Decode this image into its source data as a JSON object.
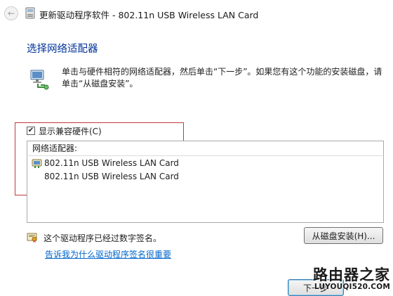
{
  "window": {
    "title": "更新驱动程序软件 - 802.11n USB Wireless LAN Card"
  },
  "main": {
    "heading": "选择网络适配器",
    "instruction": "单击与硬件相符的网络适配器，然后单击“下一步”。如果您有这个功能的安装磁盘，请单击“从磁盘安装”。",
    "show_compatible": {
      "label": "显示兼容硬件(C)",
      "checked": true
    },
    "list": {
      "header": "网络适配器:",
      "items": [
        {
          "label": "802.11n USB Wireless LAN Card",
          "icon": "network-adapter-icon"
        },
        {
          "label": "802.11n USB Wireless LAN Card"
        }
      ]
    },
    "signed_text": "这个驱动程序已经过数字签名。",
    "help_link": "告诉我为什么驱动程序签名很重要",
    "disk_button": "从磁盘安装(H)...",
    "next_button": "下一步"
  },
  "watermark": {
    "main": "路由器之家",
    "sub": "LUYOUQI520.COM"
  },
  "colors": {
    "heading": "#003399",
    "link": "#0066cc",
    "highlight_box": "#c0393b"
  }
}
